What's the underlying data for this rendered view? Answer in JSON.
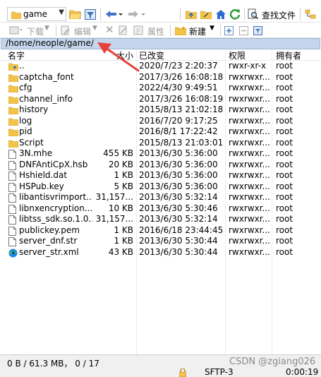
{
  "toolbar": {
    "folder_combo": "game",
    "find_files": "查找文件"
  },
  "toolbar2": {
    "download": "下载",
    "edit": "编辑",
    "properties": "属性",
    "new": "新建"
  },
  "address": "/home/neople/game/",
  "columns": [
    "名字",
    "大小",
    "已改变",
    "权限",
    "拥有者"
  ],
  "files": [
    {
      "icon": "parent-folder",
      "name": "..",
      "size": "",
      "modified": "2020/7/23 2:20:37",
      "perms": "rwxr-xr-x",
      "owner": "root"
    },
    {
      "icon": "folder",
      "name": "captcha_font",
      "size": "",
      "modified": "2017/3/26 16:08:18",
      "perms": "rwxrwxr...",
      "owner": "root"
    },
    {
      "icon": "folder",
      "name": "cfg",
      "size": "",
      "modified": "2022/4/30 9:49:51",
      "perms": "rwxrwxr...",
      "owner": "root"
    },
    {
      "icon": "folder",
      "name": "channel_info",
      "size": "",
      "modified": "2017/3/26 16:08:19",
      "perms": "rwxrwxr...",
      "owner": "root"
    },
    {
      "icon": "folder",
      "name": "history",
      "size": "",
      "modified": "2015/8/13 21:02:18",
      "perms": "rwxrwxr...",
      "owner": "root"
    },
    {
      "icon": "folder",
      "name": "log",
      "size": "",
      "modified": "2016/7/20 9:17:25",
      "perms": "rwxrwxr...",
      "owner": "root"
    },
    {
      "icon": "folder",
      "name": "pid",
      "size": "",
      "modified": "2016/8/1 17:22:42",
      "perms": "rwxrwxr...",
      "owner": "root"
    },
    {
      "icon": "folder",
      "name": "Script",
      "size": "",
      "modified": "2015/8/13 21:03:01",
      "perms": "rwxrwxr...",
      "owner": "root"
    },
    {
      "icon": "file",
      "name": "3N.mhe",
      "size": "455 KB",
      "modified": "2013/6/30 5:36:00",
      "perms": "rwxrwxr...",
      "owner": "root"
    },
    {
      "icon": "file",
      "name": "DNFAntiCpX.hsb",
      "size": "20 KB",
      "modified": "2013/6/30 5:36:00",
      "perms": "rwxrwxr...",
      "owner": "root"
    },
    {
      "icon": "file",
      "name": "Hshield.dat",
      "size": "1 KB",
      "modified": "2013/6/30 5:36:00",
      "perms": "rwxrwxr...",
      "owner": "root"
    },
    {
      "icon": "file",
      "name": "HSPub.key",
      "size": "5 KB",
      "modified": "2013/6/30 5:36:00",
      "perms": "rwxrwxr...",
      "owner": "root"
    },
    {
      "icon": "file",
      "name": "libantisvrimport....",
      "size": "31,157...",
      "modified": "2013/6/30 5:32:14",
      "perms": "rwxrwxr...",
      "owner": "root"
    },
    {
      "icon": "file",
      "name": "libnxencryption....",
      "size": "10 KB",
      "modified": "2013/6/30 5:30:46",
      "perms": "rwxrwxr...",
      "owner": "root"
    },
    {
      "icon": "file",
      "name": "libtss_sdk.so.1.0...",
      "size": "31,157...",
      "modified": "2013/6/30 5:32:14",
      "perms": "rwxrwxr...",
      "owner": "root"
    },
    {
      "icon": "file",
      "name": "publickey.pem",
      "size": "1 KB",
      "modified": "2016/6/18 23:44:45",
      "perms": "rwxrwxr...",
      "owner": "root"
    },
    {
      "icon": "file",
      "name": "server_dnf.str",
      "size": "1 KB",
      "modified": "2013/6/30 5:30:44",
      "perms": "rwxrwxr...",
      "owner": "root"
    },
    {
      "icon": "edge",
      "name": "server_str.xml",
      "size": "43 KB",
      "modified": "2013/6/30 5:30:44",
      "perms": "rwxrwxr...",
      "owner": "root"
    }
  ],
  "status": {
    "selection": "0 B / 61.3 MB，  0 / 17",
    "protocol": "SFTP-3",
    "time": "0:00:19"
  },
  "watermark": "CSDN @zgiang026",
  "colors": {
    "folder": "#f3c34a",
    "address_bg": "#c5d6ec",
    "arrow": "#e8413a"
  }
}
